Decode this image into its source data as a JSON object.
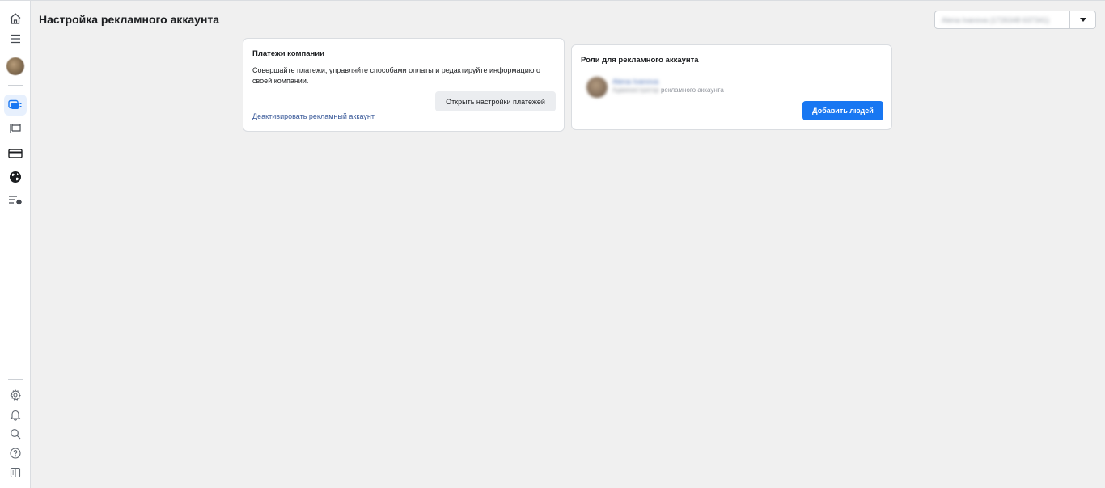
{
  "header": {
    "title": "Настройка рекламного аккаунта",
    "account_selector": {
      "value": "Alena Ivanova (1726348 637341)",
      "icon": "caret-down-icon"
    }
  },
  "sidebar": {
    "top_items": [
      {
        "name": "home",
        "icon": "home-icon"
      },
      {
        "name": "menu",
        "icon": "menu-icon"
      },
      {
        "name": "profile",
        "icon": "avatar"
      },
      {
        "name": "ad-accounts",
        "icon": "ad-account-icon",
        "active": true
      },
      {
        "name": "pages",
        "icon": "flag-icon"
      },
      {
        "name": "billing",
        "icon": "credit-card-icon"
      },
      {
        "name": "global",
        "icon": "globe-icon"
      },
      {
        "name": "settings-list",
        "icon": "list-settings-icon"
      }
    ],
    "bottom_items": [
      {
        "name": "settings",
        "icon": "gear-icon"
      },
      {
        "name": "notifications",
        "icon": "bell-icon"
      },
      {
        "name": "search",
        "icon": "search-icon"
      },
      {
        "name": "help",
        "icon": "help-icon"
      },
      {
        "name": "panel",
        "icon": "panel-icon"
      }
    ]
  },
  "payments_card": {
    "title": "Платежи компании",
    "description": "Совершайте платежи, управляйте способами оплаты и редактируйте информацию о своей компании.",
    "open_button": "Открыть настройки платежей",
    "deactivate_link": "Деактивировать рекламный аккаунт"
  },
  "roles_card": {
    "title": "Роли для рекламного аккаунта",
    "person": {
      "name": "Alena Ivanova",
      "role_prefix": "Администратор",
      "role_suffix": "рекламного аккаунта"
    },
    "add_button": "Добавить людей"
  },
  "colors": {
    "accent": "#1877f2",
    "link": "#385898",
    "background": "#f0f0f0"
  }
}
